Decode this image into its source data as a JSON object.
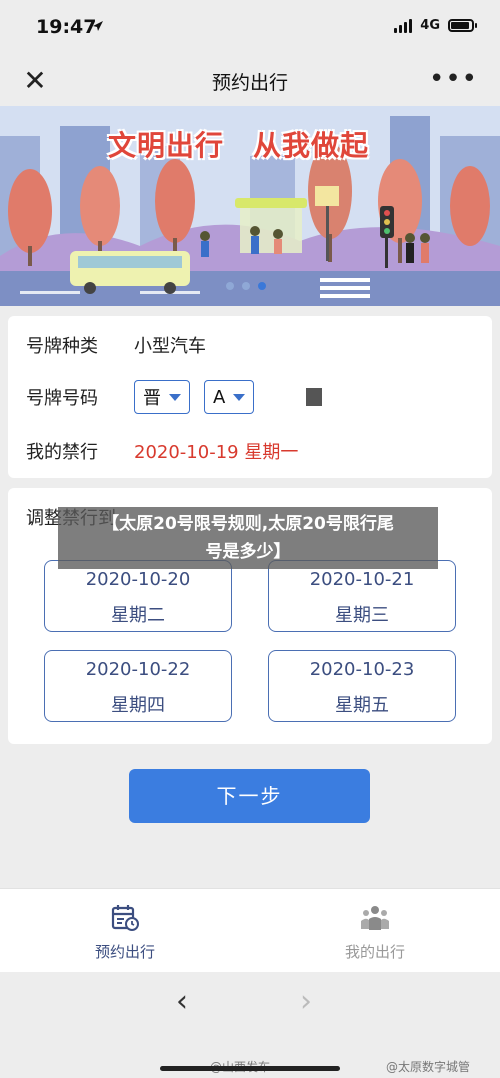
{
  "status_bar": {
    "time": "19:47",
    "network": "4G",
    "icons": [
      "location-arrow-icon",
      "signal-icon",
      "battery-icon"
    ]
  },
  "nav": {
    "close_icon": "close-icon",
    "title": "预约出行",
    "more_icon": "more-icon"
  },
  "banner": {
    "slogan": "文明出行　从我做起",
    "dot_count": 3,
    "active_dot": 2
  },
  "info": {
    "plate_type_label": "号牌种类",
    "plate_type_value": "小型汽车",
    "plate_number_label": "号牌号码",
    "province_select": "晋",
    "letter_select": "A",
    "restriction_label": "我的禁行",
    "restriction_value": "2020-10-19 星期一"
  },
  "adjust": {
    "title": "调整禁行到",
    "options": [
      {
        "date": "2020-10-20",
        "weekday": "星期二"
      },
      {
        "date": "2020-10-21",
        "weekday": "星期三"
      },
      {
        "date": "2020-10-22",
        "weekday": "星期四"
      },
      {
        "date": "2020-10-23",
        "weekday": "星期五"
      }
    ]
  },
  "overlay": {
    "caption_line1": "【太原20号限号规则,太原20号限行尾",
    "caption_line2": "号是多少】"
  },
  "next_button": "下一步",
  "tabs": [
    {
      "label": "预约出行",
      "icon": "calendar-icon",
      "active": true
    },
    {
      "label": "我的出行",
      "icon": "people-icon",
      "active": false
    }
  ],
  "browser": {
    "back_icon": "back-arrow-icon",
    "forward_icon": "forward-arrow-icon",
    "watermark_left": "@山西发布",
    "watermark_right": "@太原数字城管"
  },
  "colors": {
    "accent": "#3b7de0",
    "restriction_red": "#d83a2e",
    "option_border": "#4b6fb3",
    "slogan_red": "#e0463a"
  }
}
